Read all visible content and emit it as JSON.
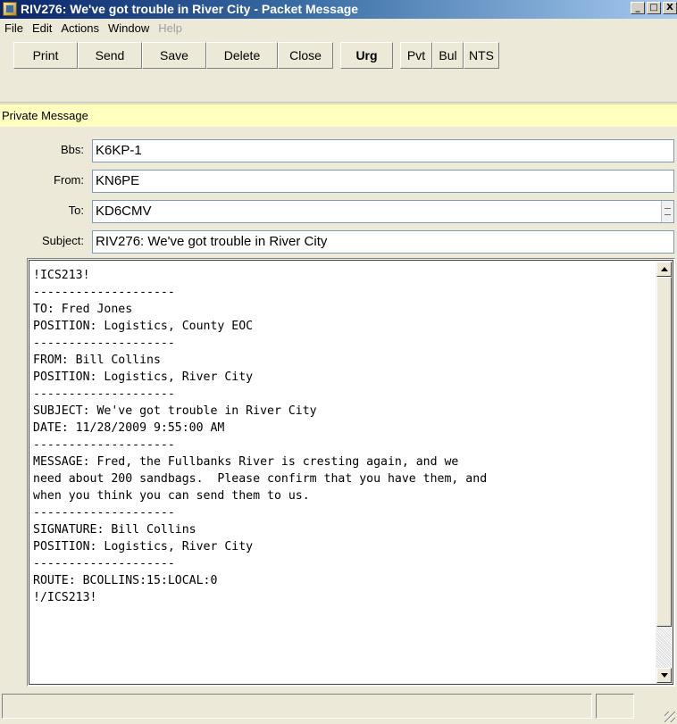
{
  "window": {
    "title": "RIV276: We've got trouble in River City - Packet Message",
    "controls": {
      "minimize": "_",
      "maximize": "□",
      "close": "X"
    }
  },
  "menu": [
    {
      "label": "File",
      "enabled": true
    },
    {
      "label": "Edit",
      "enabled": true
    },
    {
      "label": "Actions",
      "enabled": true
    },
    {
      "label": "Window",
      "enabled": true
    },
    {
      "label": "Help",
      "enabled": false
    }
  ],
  "toolbar": {
    "print": "Print",
    "send": "Send",
    "save": "Save",
    "delete": "Delete",
    "close": "Close",
    "urg": "Urg",
    "pvt": "Pvt",
    "bul": "Bul",
    "nts": "NTS"
  },
  "status_strip": "Private Message",
  "fields": {
    "bbs": {
      "label": "Bbs:",
      "value": "K6KP-1"
    },
    "from": {
      "label": "From:",
      "value": "KN6PE"
    },
    "to": {
      "label": "To:",
      "value": "KD6CMV"
    },
    "subject": {
      "label": "Subject:",
      "value": "RIV276: We've got trouble in River City"
    }
  },
  "message": {
    "body": "!ICS213!\n--------------------\nTO: Fred Jones\nPOSITION: Logistics, County EOC\n--------------------\nFROM: Bill Collins\nPOSITION: Logistics, River City\n--------------------\nSUBJECT: We've got trouble in River City\nDATE: 11/28/2009 9:55:00 AM\n--------------------\nMESSAGE: Fred, the Fullbanks River is cresting again, and we\nneed about 200 sandbags.  Please confirm that you have them, and\nwhen you think you can send them to us.\n--------------------\nSIGNATURE: Bill Collins\nPOSITION: Logistics, River City\n--------------------\nROUTE: BCOLLINS:15:LOCAL:0\n!/ICS213!"
  }
}
